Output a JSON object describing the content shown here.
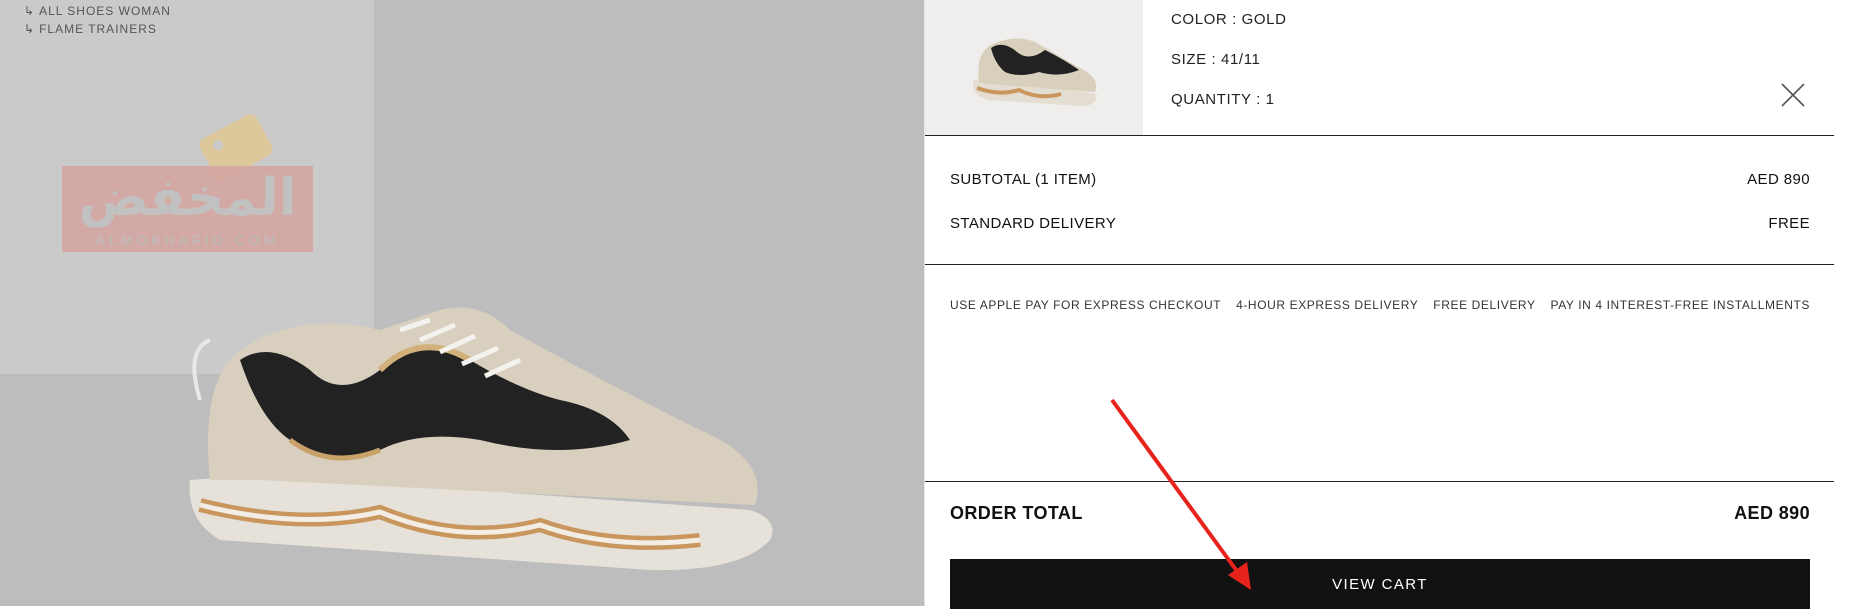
{
  "breadcrumb": [
    {
      "label": "ALL SHOES WOMAN"
    },
    {
      "label": "FLAME TRAINERS"
    }
  ],
  "watermark": {
    "arabic": "المخفض",
    "latin": "ALMOKHAFID.COM"
  },
  "cart_item": {
    "color_line": "COLOR : GOLD",
    "size_line": "SIZE : 41/11",
    "quantity_line": "QUANTITY : 1"
  },
  "summary": {
    "subtotal_label": "SUBTOTAL (1 ITEM)",
    "subtotal_value": "AED 890",
    "delivery_label": "STANDARD DELIVERY",
    "delivery_value": "FREE"
  },
  "perks": [
    "USE APPLE PAY FOR EXPRESS CHECKOUT",
    "4-HOUR EXPRESS DELIVERY",
    "FREE DELIVERY",
    "PAY IN 4 INTEREST-FREE INSTALLMENTS"
  ],
  "order_total": {
    "label": "ORDER TOTAL",
    "value": "AED 890"
  },
  "view_cart_label": "VIEW CART",
  "colors": {
    "accent_arrow": "#e8231c",
    "button_bg": "#111111"
  }
}
